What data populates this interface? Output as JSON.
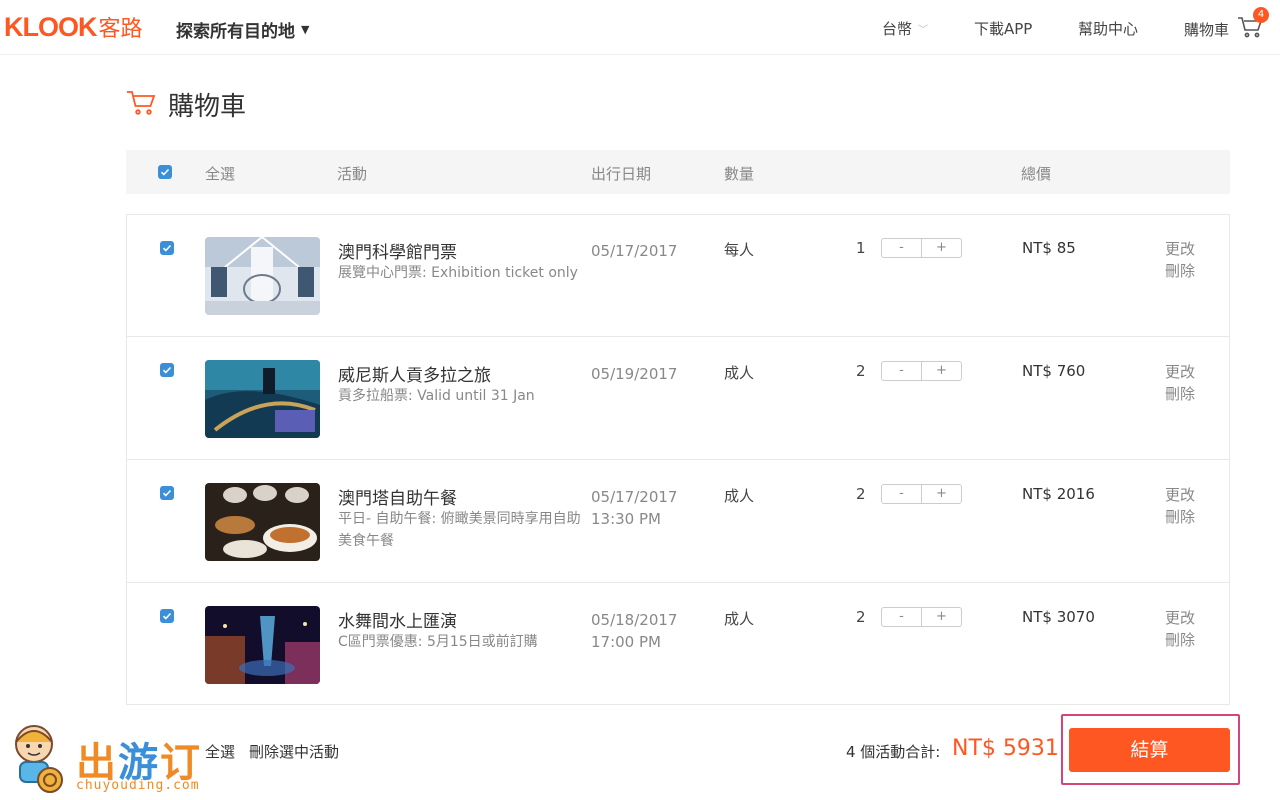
{
  "brand": {
    "logo_en": "KLOOK",
    "logo_zh": "客路",
    "accent": "#ff5722"
  },
  "header": {
    "explore": "探索所有目的地",
    "currency": "台幣",
    "download": "下載APP",
    "help": "幫助中心",
    "cart": "購物車",
    "cart_count": "4"
  },
  "page": {
    "title": "購物車"
  },
  "table_head": {
    "select_all": "全選",
    "activity": "活動",
    "date": "出行日期",
    "quantity": "數量",
    "total": "總價"
  },
  "items": [
    {
      "title": "澳門科學館門票",
      "sub": "展覽中心門票: Exhibition ticket only",
      "date": "05/17/2017",
      "time": "",
      "unit": "每人",
      "qty": "1",
      "price": "NT$ 85",
      "edit": "更改",
      "delete": "刪除"
    },
    {
      "title": "威尼斯人貢多拉之旅",
      "sub": "貢多拉船票: Valid until 31 Jan",
      "date": "05/19/2017",
      "time": "",
      "unit": "成人",
      "qty": "2",
      "price": "NT$ 760",
      "edit": "更改",
      "delete": "刪除"
    },
    {
      "title": "澳門塔自助午餐",
      "sub": "平日- 自助午餐: 俯瞰美景同時享用自助美食午餐",
      "date": "05/17/2017",
      "time": "13:30 PM",
      "unit": "成人",
      "qty": "2",
      "price": "NT$ 2016",
      "edit": "更改",
      "delete": "刪除"
    },
    {
      "title": "水舞間水上匯演",
      "sub": "C區門票優惠: 5月15日或前訂購",
      "date": "05/18/2017",
      "time": "17:00 PM",
      "unit": "成人",
      "qty": "2",
      "price": "NT$ 3070",
      "edit": "更改",
      "delete": "刪除"
    }
  ],
  "stepper": {
    "minus": "-",
    "plus": "+"
  },
  "footer": {
    "select_all": "全選",
    "delete_selected": "刪除選中活動",
    "count_label": "4 個活動合計:",
    "total": "NT$ 5931",
    "checkout": "結算"
  },
  "watermark": {
    "text_1": "出",
    "text_2": "游",
    "text_3": "订",
    "url": "chuyouding.com"
  }
}
